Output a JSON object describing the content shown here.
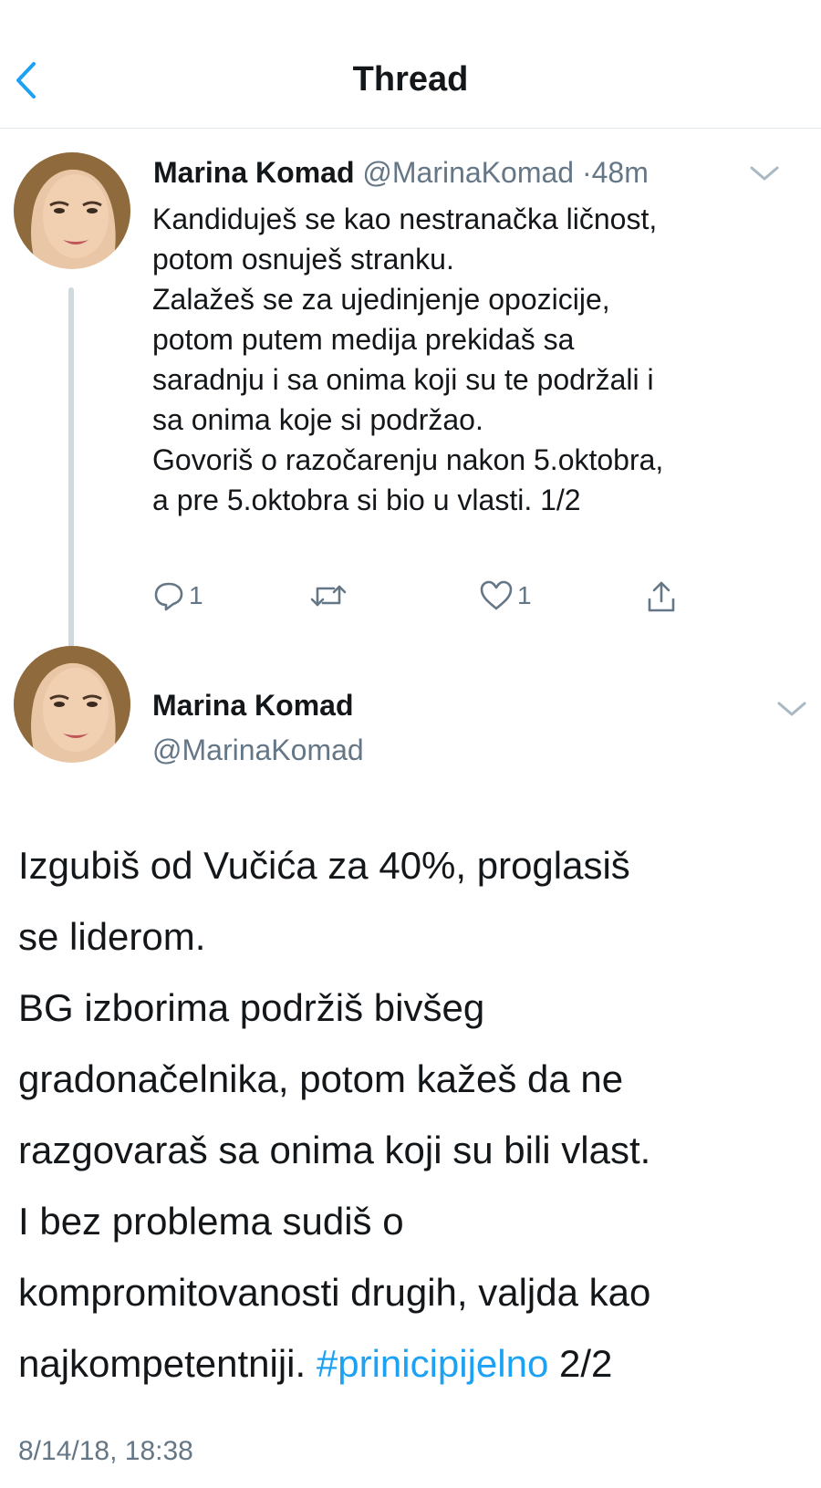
{
  "header": {
    "title": "Thread",
    "back_icon": "chevron-left-icon"
  },
  "colors": {
    "accent": "#1da1f2",
    "secondary_text": "#657786",
    "thread_line": "#cfd9de"
  },
  "tweet1": {
    "name": "Marina Komad",
    "handle": "@MarinaKomad",
    "separator": "·",
    "time": "48m",
    "lines": [
      "Kandiduješ se kao nestranačka ličnost,",
      "potom osnuješ stranku.",
      "Zalažeš se za ujedinjenje opozicije,",
      "potom putem medija prekidaš sa",
      "saradnju i sa onima koji su te podržali i",
      "sa onima koje si podržao.",
      "Govoriš o razočarenju nakon 5.oktobra,",
      "a pre 5.oktobra si bio u vlasti. 1/2"
    ],
    "reply_count": "1",
    "like_count": "1"
  },
  "tweet2": {
    "name": "Marina Komad",
    "handle": "@MarinaKomad",
    "lines": [
      "Izgubiš od Vučića za 40%, proglasiš",
      "se liderom.",
      "BG izborima podržiš bivšeg",
      "gradonačelnika, potom kažeš da ne",
      "razgovaraš sa onima koji su bili vlast.",
      "I bez problema sudiš o",
      "kompromitovanosti drugih, valjda kao"
    ],
    "last_line_prefix": "najkompetentniji. ",
    "hashtag": "#prinicipijelno",
    "last_line_suffix": " 2/2",
    "timestamp": "8/14/18, 18:38"
  }
}
